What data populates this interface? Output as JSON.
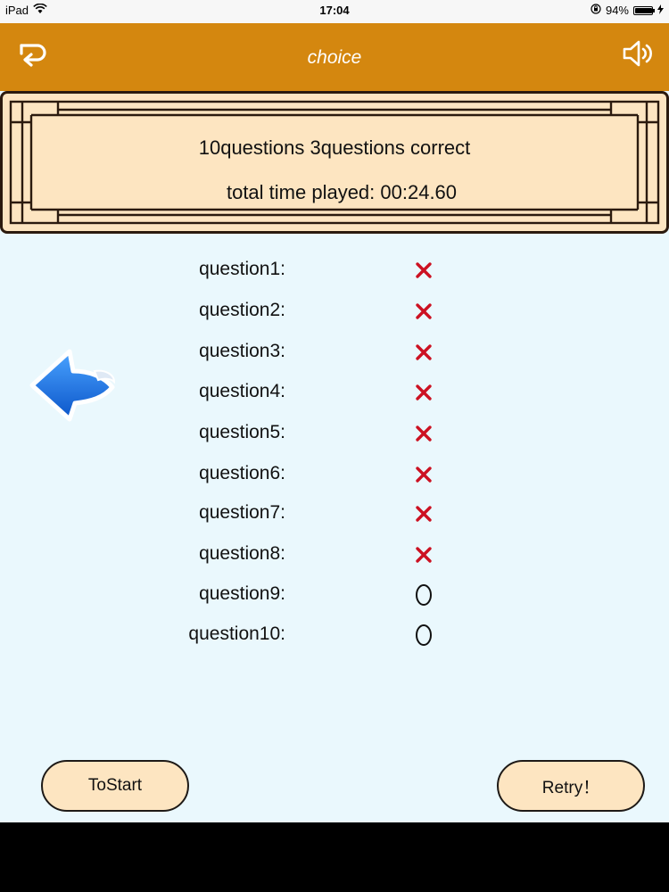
{
  "status_bar": {
    "device": "iPad",
    "time": "17:04",
    "battery_text": "94%",
    "battery_level": 0.94
  },
  "nav": {
    "title": "choice",
    "back_icon": "return-icon",
    "sound_icon": "speaker-icon",
    "color": "#d4870f"
  },
  "summary": {
    "line1": "10questions 3questions correct",
    "line2": "total time played: 00:24.60"
  },
  "results": [
    {
      "label": "question1:",
      "correct": false
    },
    {
      "label": "question2:",
      "correct": false
    },
    {
      "label": "question3:",
      "correct": false
    },
    {
      "label": "question4:",
      "correct": false
    },
    {
      "label": "question5:",
      "correct": false
    },
    {
      "label": "question6:",
      "correct": false
    },
    {
      "label": "question7:",
      "correct": false
    },
    {
      "label": "question8:",
      "correct": false
    },
    {
      "label": "question9:",
      "correct": true
    },
    {
      "label": "question10:",
      "correct": true
    }
  ],
  "buttons": {
    "to_start": "ToStart",
    "retry": "Retry！"
  },
  "colors": {
    "wrong_mark": "#cc1122",
    "panel_bg": "#fde5c1",
    "page_bg": "#eaf8fd",
    "arrow": "#1b6fe0"
  }
}
